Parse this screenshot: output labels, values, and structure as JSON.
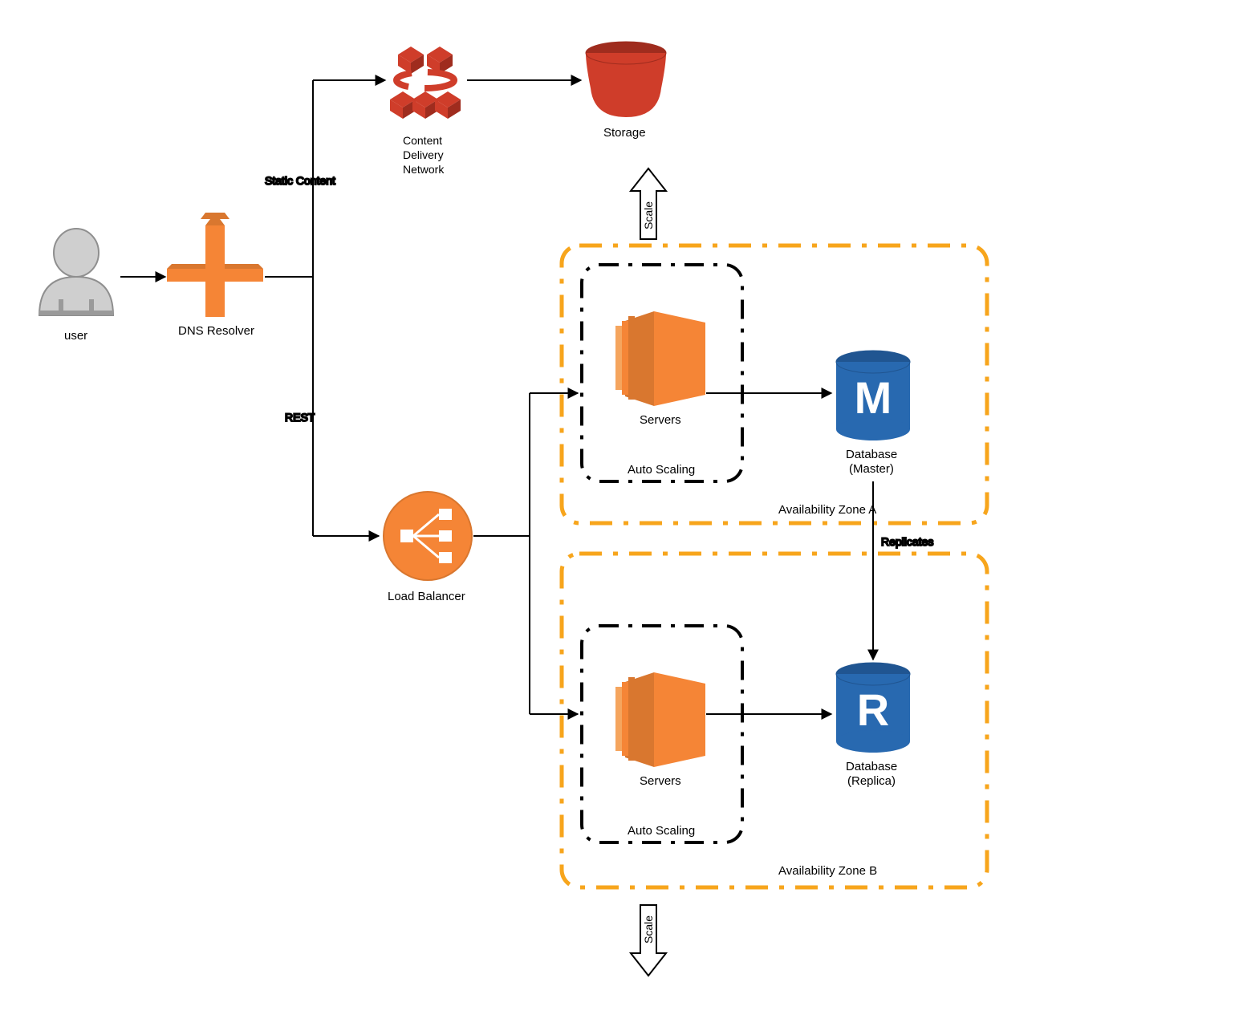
{
  "nodes": {
    "user": {
      "label": "user"
    },
    "dns": {
      "label": "DNS Resolver"
    },
    "cdn": {
      "label_l1": "Content",
      "label_l2": "Delivery",
      "label_l3": "Network"
    },
    "storage": {
      "label": "Storage"
    },
    "lb": {
      "label": "Load Balancer"
    },
    "servers_a": {
      "label": "Servers"
    },
    "servers_b": {
      "label": "Servers"
    },
    "asg_a": {
      "label": "Auto Scaling"
    },
    "asg_b": {
      "label": "Auto Scaling"
    },
    "az_a": {
      "label": "Availability Zone A"
    },
    "az_b": {
      "label": "Availability Zone B"
    },
    "db_master": {
      "label_l1": "Database",
      "label_l2": "(Master)",
      "letter": "M"
    },
    "db_replica": {
      "label_l1": "Database",
      "label_l2": "(Replica)",
      "letter": "R"
    }
  },
  "edges": {
    "static_content": "Static Content",
    "rest": "REST",
    "replicates": "Replicates",
    "scale_a": "Scale",
    "scale_b": "Scale"
  },
  "colors": {
    "orange": "#f58536",
    "orange_dark": "#d9772f",
    "red": "#cf3d2a",
    "red_dark": "#9f2c1e",
    "blue": "#2869b0",
    "blue_dark": "#205591",
    "az_border": "#f7a51c",
    "grey": "#cfcfcf",
    "grey_dark": "#a0a0a0"
  }
}
